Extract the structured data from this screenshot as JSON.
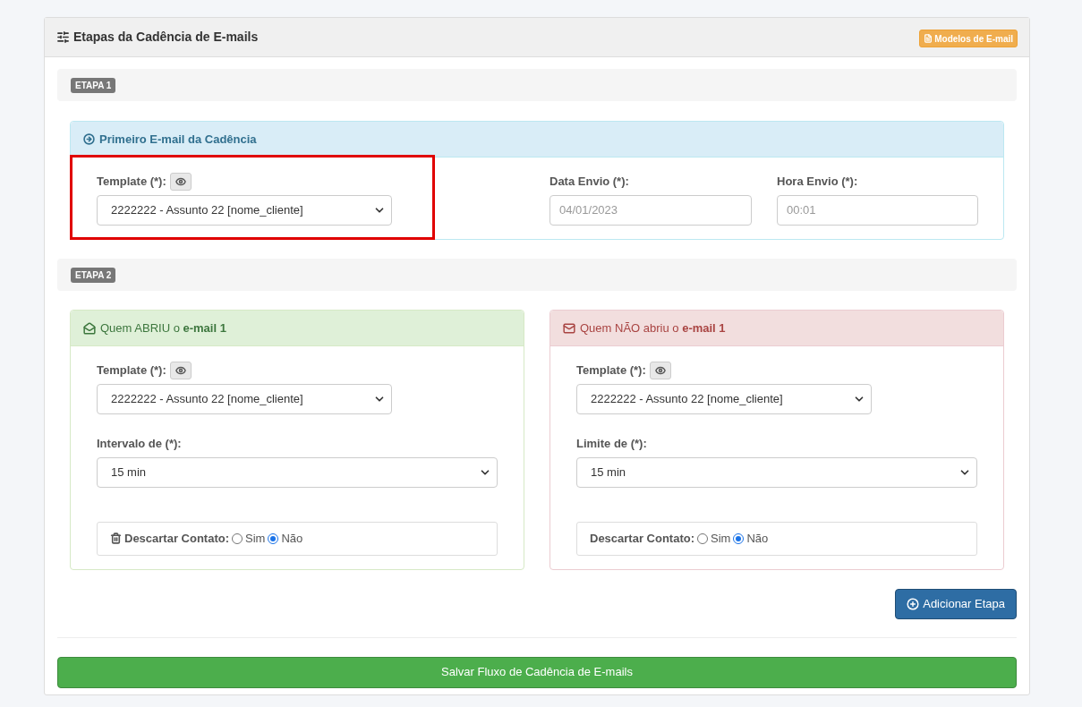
{
  "panel": {
    "title": "Etapas da Cadência de E-mails",
    "templates_button": "Modelos de E-mail"
  },
  "step1": {
    "badge": "ETAPA 1",
    "card": {
      "title": "Primeiro E-mail da Cadência",
      "template_label": "Template (*):",
      "template_value": "2222222 - Assunto 22 [nome_cliente]",
      "highlighted": true,
      "date_label": "Data Envio (*):",
      "date_placeholder": "04/01/2023",
      "time_label": "Hora Envio (*):",
      "time_placeholder": "00:01"
    }
  },
  "step2": {
    "badge": "ETAPA 2",
    "cards": [
      {
        "kind": "opened",
        "title": "Quem ABRIU o **e-mail 1**",
        "template_label": "Template (*):",
        "template_value": "2222222 - Assunto 22 [nome_cliente]",
        "delay_label": "Intervalo de (*):",
        "delay_value": "15 min",
        "discard": {
          "trash_icon": true,
          "label": "Descartar Contato:",
          "options": [
            {
              "label": "Sim",
              "selected": false
            },
            {
              "label": "Não",
              "selected": true
            }
          ]
        }
      },
      {
        "kind": "unopened",
        "title": "Quem NÃO abriu o **e-mail 1**",
        "template_label": "Template (*):",
        "template_value": "2222222 - Assunto 22 [nome_cliente]",
        "delay_label": "Limite de (*):",
        "delay_value": "15 min",
        "discard": {
          "trash_icon": false,
          "label": "Descartar Contato:",
          "options": [
            {
              "label": "Sim",
              "selected": false
            },
            {
              "label": "Não",
              "selected": true
            }
          ]
        }
      }
    ]
  },
  "add_step_button": "Adicionar Etapa",
  "save_button": "Salvar Fluxo de Cadência de E-mails"
}
